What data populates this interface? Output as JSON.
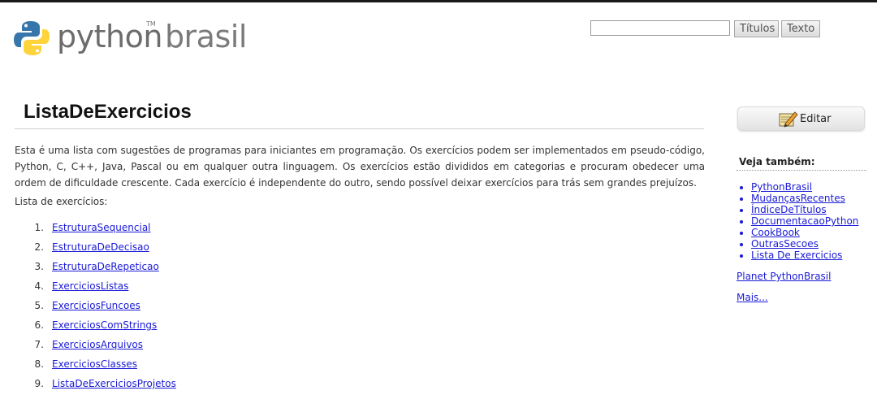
{
  "header": {
    "logo": {
      "word1": "python",
      "tm": "TM",
      "word2": "brasil"
    },
    "search": {
      "value": "",
      "btn_titulos": "Títulos",
      "btn_texto": "Texto"
    }
  },
  "main": {
    "title": "ListaDeExercicios",
    "intro": "Esta é uma lista com sugestões de programas para iniciantes em programação. Os exercícios podem ser implementados em pseudo-código, Python, C, C++, Java, Pascal ou em qualquer outra linguagem. Os exercícios estão divididos em categorias e procuram obedecer uma ordem de dificuldade crescente. Cada exercício é independente do outro, sendo possível deixar exercícios para trás sem grandes prejuízos.",
    "list_heading": "Lista de exercícios:",
    "exercises": [
      {
        "num": "1.",
        "label": "EstruturaSequencial"
      },
      {
        "num": "2.",
        "label": "EstruturaDeDecisao"
      },
      {
        "num": "3.",
        "label": "EstruturaDeRepeticao"
      },
      {
        "num": "4.",
        "label": "ExerciciosListas"
      },
      {
        "num": "5.",
        "label": "ExerciciosFuncoes"
      },
      {
        "num": "6.",
        "label": "ExerciciosComStrings"
      },
      {
        "num": "7.",
        "label": "ExerciciosArquivos"
      },
      {
        "num": "8.",
        "label": "ExerciciosClasses"
      },
      {
        "num": "9.",
        "label": "ListaDeExerciciosProjetos"
      }
    ]
  },
  "sidebar": {
    "edit_label": "Editar",
    "see_also_title": "Veja também:",
    "see_also": [
      "PythonBrasil",
      "MudançasRecentes",
      "ÍndiceDeTítulos",
      "DocumentacaoPython",
      "CookBook",
      "OutrasSecoes",
      "Lista De Exercicios"
    ],
    "planet": "Planet PythonBrasil",
    "more": "Mais..."
  },
  "colors": {
    "link": "#1a1ad6",
    "python_blue": "#3776ab",
    "python_yellow": "#ffd43b"
  }
}
